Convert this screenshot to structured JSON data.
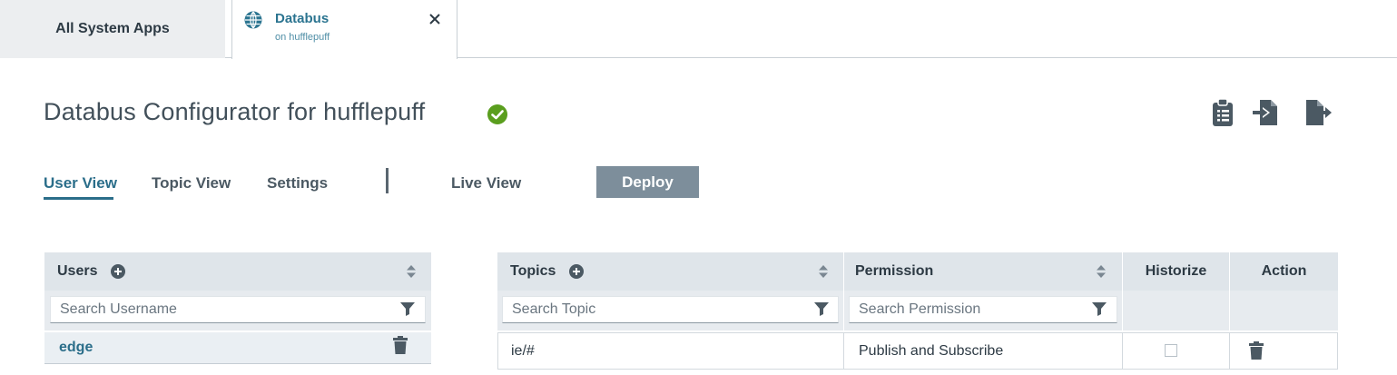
{
  "tabs": {
    "all_apps": "All System Apps",
    "databus_title": "Databus",
    "databus_subtitle": "on hufflepuff"
  },
  "header": {
    "title": "Databus Configurator for hufflepuff",
    "status": "ok",
    "actions": [
      "clipboard-icon",
      "import-icon",
      "export-icon"
    ]
  },
  "nav": {
    "user_view": "User View",
    "topic_view": "Topic View",
    "settings": "Settings",
    "live_view": "Live View",
    "deploy": "Deploy",
    "active": "User View"
  },
  "users_table": {
    "header": "Users",
    "search_placeholder": "Search Username",
    "rows": [
      {
        "name": "edge"
      }
    ]
  },
  "topics_table": {
    "headers": {
      "topics": "Topics",
      "permission": "Permission",
      "historize": "Historize",
      "action": "Action"
    },
    "search_topic_placeholder": "Search Topic",
    "search_permission_placeholder": "Search Permission",
    "rows": [
      {
        "topic": "ie/#",
        "permission": "Publish and Subscribe",
        "historize": false
      }
    ]
  },
  "colors": {
    "accent": "#2b6e8a",
    "success": "#5a9e1e",
    "header_bg": "#dfe5ea",
    "deploy_bg": "#7d8e9b"
  }
}
